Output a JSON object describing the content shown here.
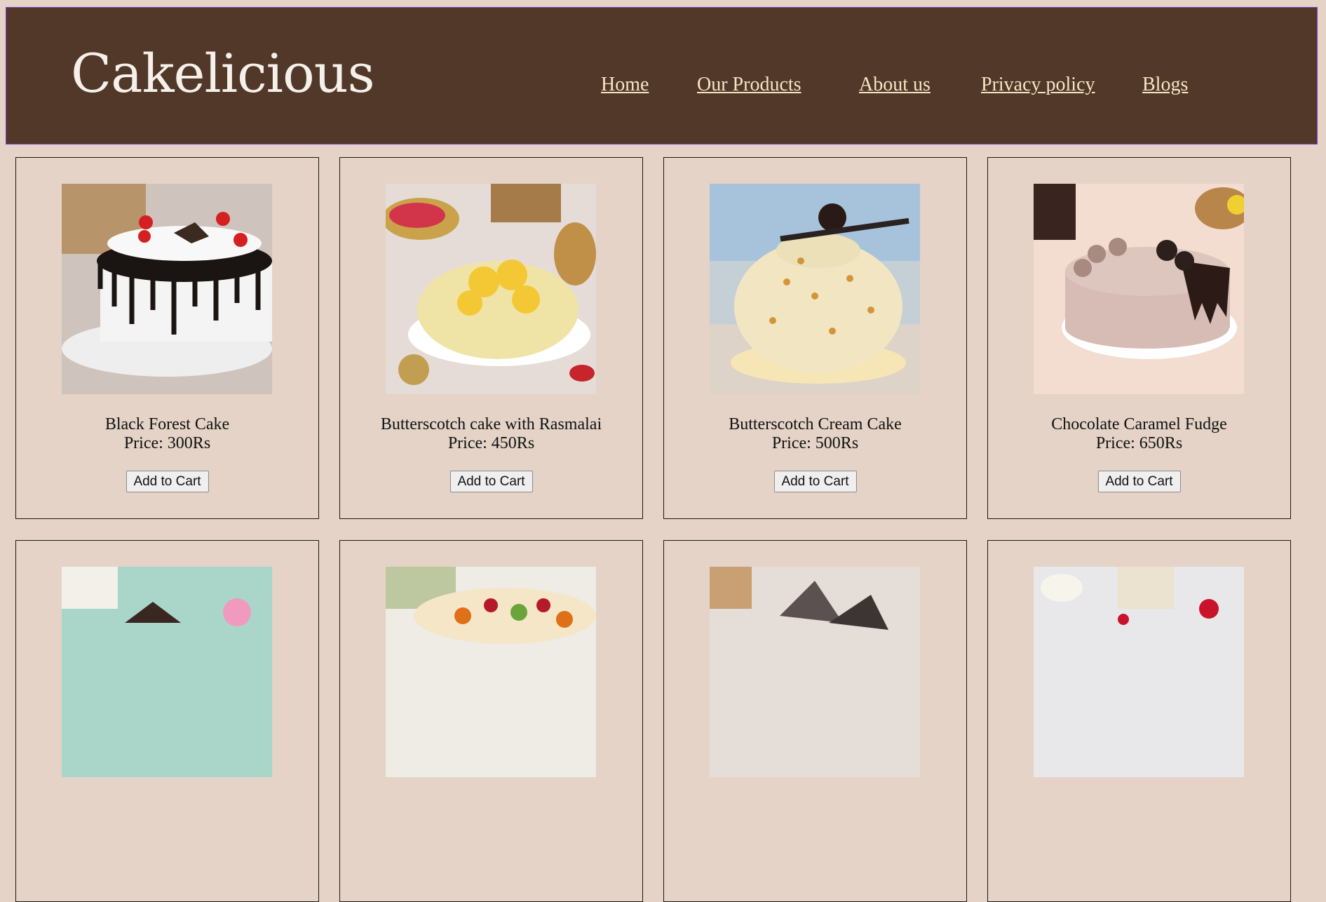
{
  "header": {
    "brand": "Cakelicious",
    "nav": [
      "Home",
      "Our Products",
      "About us",
      "Privacy policy",
      "Blogs"
    ]
  },
  "colors": {
    "header_bg": "#513828",
    "page_bg": "#e4d3c6",
    "nav_link": "#f6e5c6",
    "brand_text": "#f5f0ea"
  },
  "products": [
    {
      "name": "Black Forest Cake",
      "price": "Price: 300Rs",
      "button": "Add to Cart",
      "image": "black-forest-cake-image"
    },
    {
      "name": "Butterscotch cake with Rasmalai",
      "price": "Price: 450Rs",
      "button": "Add to Cart",
      "image": "rasmalai-cake-image"
    },
    {
      "name": "Butterscotch Cream Cake",
      "price": "Price: 500Rs",
      "button": "Add to Cart",
      "image": "butterscotch-cream-cake-image"
    },
    {
      "name": "Chocolate Caramel Fudge",
      "price": "Price: 650Rs",
      "button": "Add to Cart",
      "image": "chocolate-caramel-fudge-image"
    }
  ],
  "products_row2": [
    {
      "image": "cake-image-5"
    },
    {
      "image": "fruit-cake-image"
    },
    {
      "image": "chocolate-shards-cake-image"
    },
    {
      "image": "cherry-cake-image"
    }
  ]
}
